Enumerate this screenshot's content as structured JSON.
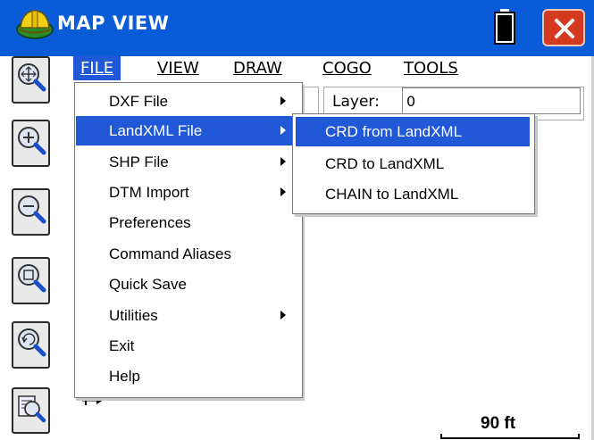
{
  "window": {
    "title": "MAP VIEW",
    "app_icon": "surveyor-hardhat-icon",
    "battery_icon": "battery-icon",
    "close_icon": "close-icon",
    "colors": {
      "titlebar": "#0a5bd8",
      "close": "#d43a1f",
      "highlight": "#2058d8"
    }
  },
  "toolbar": {
    "buttons": [
      {
        "icon": "zoom-extents-icon"
      },
      {
        "icon": "zoom-in-icon"
      },
      {
        "icon": "zoom-out-icon"
      },
      {
        "icon": "zoom-window-icon"
      },
      {
        "icon": "zoom-previous-icon"
      },
      {
        "icon": "zoom-object-icon"
      }
    ]
  },
  "menubar": {
    "items": [
      {
        "label": "FILE",
        "active": true
      },
      {
        "label": "VIEW"
      },
      {
        "label": "DRAW"
      },
      {
        "label": "COGO"
      },
      {
        "label": "TOOLS"
      }
    ]
  },
  "layer": {
    "label": "Layer:",
    "value": "0"
  },
  "file_menu": {
    "items": [
      {
        "label": "DXF File",
        "submenu": true
      },
      {
        "label": "LandXML File",
        "submenu": true,
        "highlighted": true
      },
      {
        "label": "SHP File",
        "submenu": true
      },
      {
        "label": "DTM Import",
        "submenu": true
      },
      {
        "label": "Preferences"
      },
      {
        "label": "Command Aliases"
      },
      {
        "label": "Quick Save"
      },
      {
        "label": "Utilities",
        "submenu": true
      },
      {
        "label": "Exit"
      },
      {
        "label": "Help"
      }
    ]
  },
  "landxml_submenu": {
    "items": [
      {
        "label": "CRD from LandXML",
        "highlighted": true
      },
      {
        "label": "CRD to LandXML"
      },
      {
        "label": "CHAIN to LandXML"
      }
    ]
  },
  "scale": {
    "text": "90 ft"
  }
}
